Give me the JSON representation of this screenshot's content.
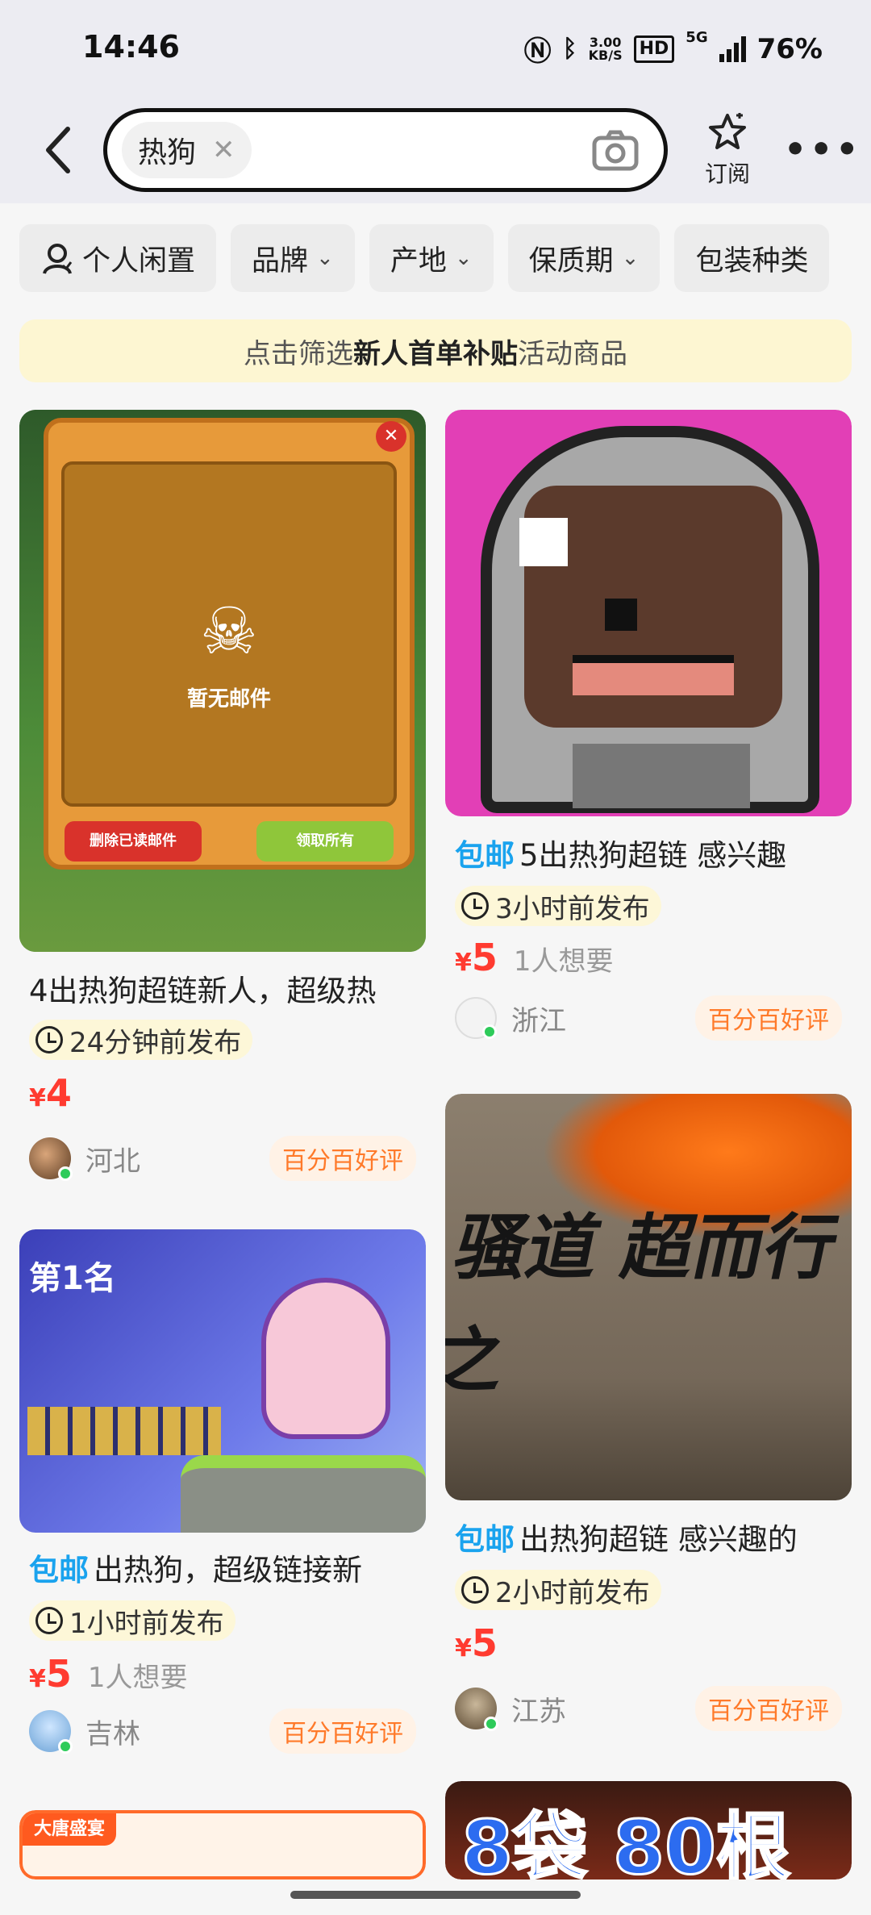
{
  "status_bar": {
    "time": "14:46",
    "net_speed": "3.00\nKB/S",
    "hd": "HD",
    "signal": "5G",
    "battery": "76%"
  },
  "header": {
    "search_chip": "热狗",
    "subscribe_label": "订阅"
  },
  "filters": [
    {
      "label": "个人闲置",
      "has_icon": true
    },
    {
      "label": "品牌",
      "chevron": true
    },
    {
      "label": "产地",
      "chevron": true
    },
    {
      "label": "保质期",
      "chevron": true
    },
    {
      "label": "包装种类",
      "chevron": false
    }
  ],
  "banner": {
    "prefix": "点击筛选",
    "highlight": "新人首单补贴",
    "suffix": "活动商品"
  },
  "cards": [
    {
      "tag": "",
      "title": "4出热狗超链新人，超级热",
      "time": "24分钟前发布",
      "price": "4",
      "wants": "",
      "region": "河北",
      "badge": "百分百好评",
      "image_text": "暂无邮件",
      "image_btn1": "删除已读邮件",
      "image_btn2": "领取所有"
    },
    {
      "tag": "包邮",
      "title": "5出热狗超链 感兴趣",
      "time": "3小时前发布",
      "price": "5",
      "wants": "1人想要",
      "region": "浙江",
      "badge": "百分百好评"
    },
    {
      "tag": "包邮",
      "title": "出热狗，超级链接新",
      "time": "1小时前发布",
      "price": "5",
      "wants": "1人想要",
      "region": "吉林",
      "badge": "百分百好评",
      "image_text": "第1名"
    },
    {
      "tag": "包邮",
      "title": "出热狗超链 感兴趣的",
      "time": "2小时前发布",
      "price": "5",
      "wants": "",
      "region": "江苏",
      "badge": "百分百好评",
      "image_text": "骚道 超而行之"
    },
    {
      "image_text": "大唐盛宴"
    },
    {
      "image_text": "8袋 80根"
    }
  ],
  "currency": "¥",
  "colors": {
    "accent_red": "#ff3b30",
    "tag_blue": "#1aa3ee",
    "badge_orange": "#ff7a2a"
  }
}
